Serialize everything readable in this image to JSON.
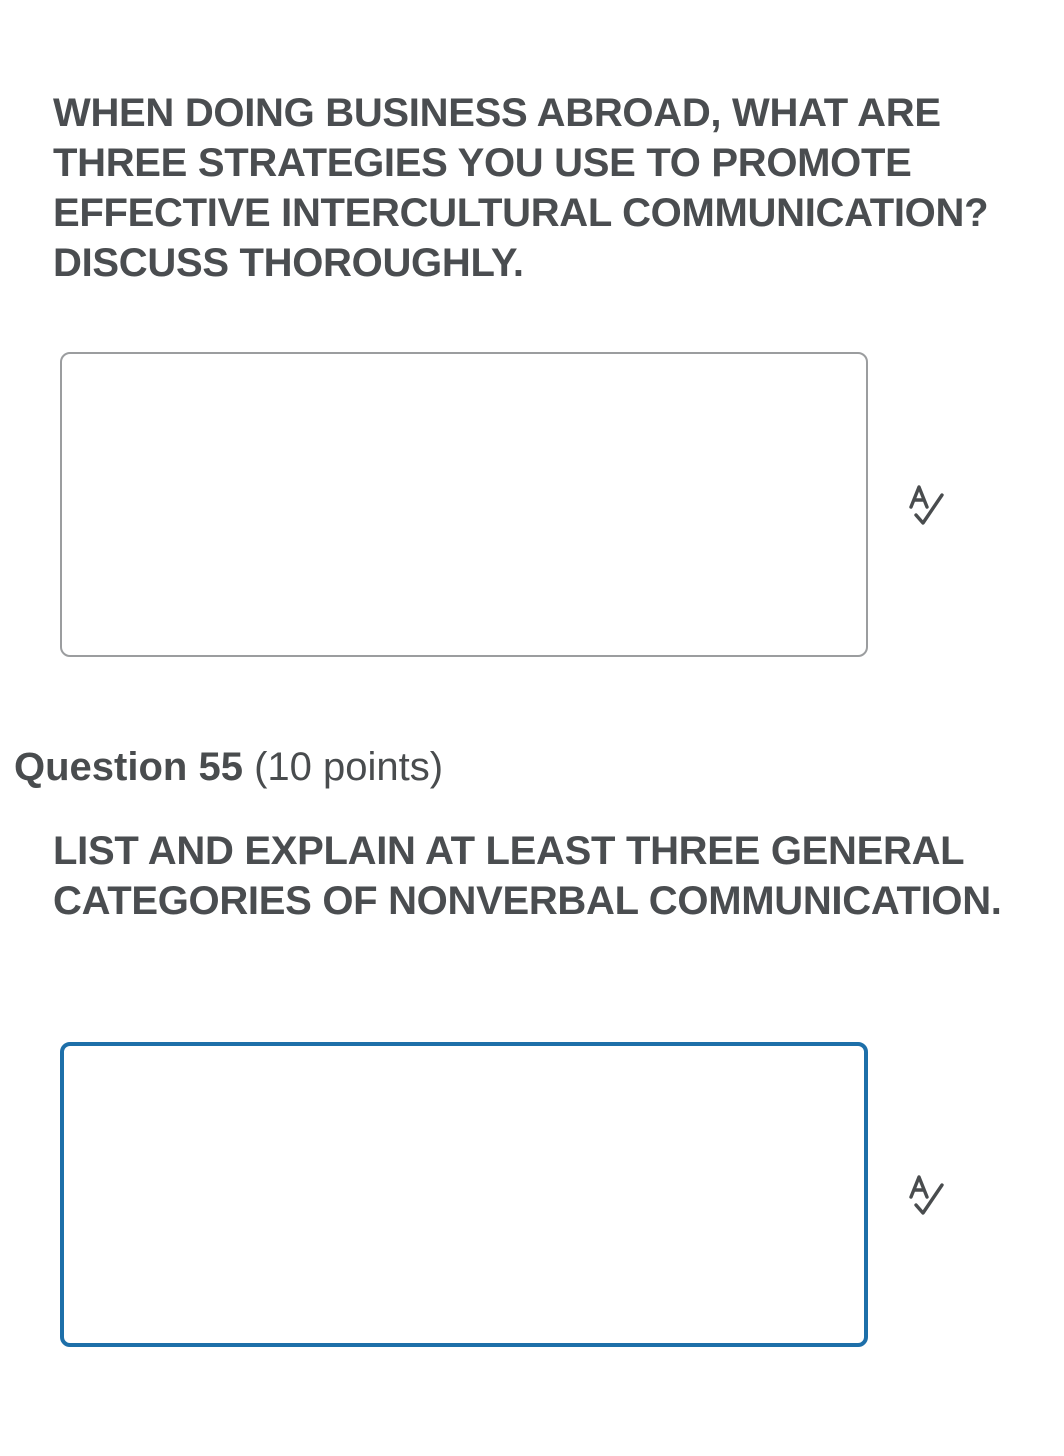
{
  "question_54": {
    "prompt": "WHEN DOING BUSINESS ABROAD, WHAT ARE THREE STRATEGIES YOU USE TO PROMOTE EFFECTIVE INTERCULTURAL COMMUNICATION? DISCUSS THOROUGHLY.",
    "answer_value": "",
    "spellcheck_icon": "spellcheck-icon"
  },
  "question_55": {
    "title": "Question 55",
    "points": "(10 points)",
    "prompt": "LIST AND EXPLAIN AT LEAST THREE GENERAL CATEGORIES OF NONVERBAL COMMUNICATION.",
    "answer_value": "",
    "spellcheck_icon": "spellcheck-icon",
    "focused": true
  },
  "colors": {
    "text": "#494c4e",
    "box_border": "#9b9d9f",
    "focus_border": "#1d6fa9",
    "background": "#ffffff"
  }
}
